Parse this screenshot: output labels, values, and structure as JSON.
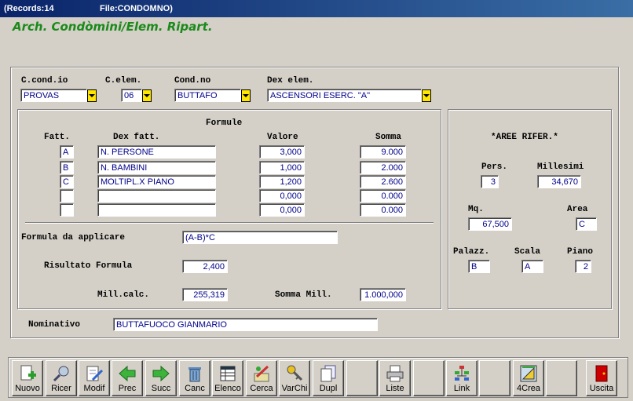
{
  "window": {
    "records_label": "(Records:14",
    "file_label": "File:CONDOMNO)"
  },
  "heading": "Arch. Condòmini/Elem. Ripart.",
  "top": {
    "c_cond_label": "C.cond.io",
    "c_cond_value": "PROVAS",
    "c_elem_label": "C.elem.",
    "c_elem_value": "06",
    "cond_no_label": "Cond.no",
    "cond_no_value": "BUTTAFO",
    "dex_elem_label": "Dex elem.",
    "dex_elem_value": "ASCENSORI ESERC. \"A\""
  },
  "formule": {
    "title": "Formule",
    "col_fatt": "Fatt.",
    "col_dex": "Dex fatt.",
    "col_valore": "Valore",
    "col_somma": "Somma",
    "rows": [
      {
        "fatt": "A",
        "dex": "N. PERSONE",
        "valore": "3,000",
        "somma": "9.000"
      },
      {
        "fatt": "B",
        "dex": "N. BAMBINI",
        "valore": "1,000",
        "somma": "2.000"
      },
      {
        "fatt": "C",
        "dex": "MOLTIPL.X PIANO",
        "valore": "1,200",
        "somma": "2.600"
      },
      {
        "fatt": "",
        "dex": "",
        "valore": "0,000",
        "somma": "0.000"
      },
      {
        "fatt": "",
        "dex": "",
        "valore": "0,000",
        "somma": "0.000"
      }
    ],
    "formula_label": "Formula da applicare",
    "formula_value": "(A-B)*C",
    "risultato_label": "Risultato Formula",
    "risultato_value": "2,400",
    "mill_calc_label": "Mill.calc.",
    "mill_calc_value": "255,319",
    "somma_mill_label": "Somma Mill.",
    "somma_mill_value": "1.000,000"
  },
  "aree": {
    "title": "*AREE RIFER.*",
    "pers_label": "Pers.",
    "pers_value": "3",
    "millesimi_label": "Millesimi",
    "millesimi_value": "34,670",
    "mq_label": "Mq.",
    "mq_value": "67,500",
    "area_label": "Area",
    "area_value": "C",
    "palazz_label": "Palazz.",
    "palazz_value": "B",
    "scala_label": "Scala",
    "scala_value": "A",
    "piano_label": "Piano",
    "piano_value": "2"
  },
  "nominativo": {
    "label": "Nominativo",
    "value": "BUTTAFUOCO GIANMARIO"
  },
  "toolbar": {
    "nuovo": "Nuovo",
    "ricer": "Ricer",
    "modif": "Modif",
    "prec": "Prec",
    "succ": "Succ",
    "canc": "Canc",
    "elenco": "Elenco",
    "cerca": "Cerca",
    "varchi": "VarChi",
    "dupl": "Dupl",
    "liste": "Liste",
    "link": "Link",
    "crea4": "4Crea",
    "uscita": "Uscita"
  }
}
